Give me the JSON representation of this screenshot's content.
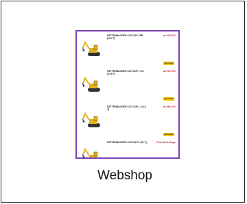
{
  "caption": "Webshop",
  "colors": {
    "border": "#7a3fb3",
    "price": "#d2202f",
    "button": "#f5c400"
  },
  "items": [
    {
      "title": "KETTENBAGGER CAT 311F LRR (13,7 T)",
      "price": "ab 379,00 €",
      "button": "Jetzt mieten"
    },
    {
      "title": "KETTENBAGGER CAT 313F L GC (14,6 T)",
      "price": "ab 379,15 €",
      "button": "Jetzt mieten"
    },
    {
      "title": "KETTENBAGGER CAT 313E L (14,6 T)",
      "price": "ab 380,15 €",
      "button": "Jetzt mieten"
    },
    {
      "title": "KETTENBAGGER CAT 316 FL (20 T)",
      "price": "Preis auf Anfrage",
      "button": ""
    }
  ]
}
